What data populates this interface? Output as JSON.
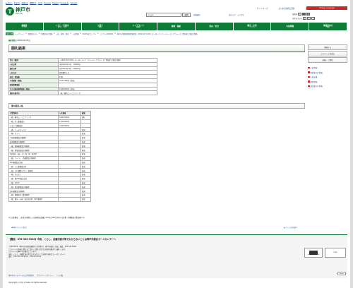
{
  "header": {
    "top_links": [
      "▶ 本文へ",
      "English",
      "简体中文",
      "繁體中文",
      "한국어",
      "Français",
      "Español",
      "Português",
      "Vietnam"
    ],
    "logo_text": "神戸市",
    "logo_sub": "Kobe City",
    "logo_mark": "T",
    "sitemap": "サイトマップ",
    "faq": "よくある質問と回答",
    "language": "Foreign Language",
    "search_placeholder": "Google",
    "search_button": "検索",
    "detail_search": "詳細検索",
    "reading": "読み上げ・ふりがな",
    "bg_label": "背景色",
    "text_size_label": "文字の大きさ",
    "bg_options": [
      "白",
      "黒",
      "青"
    ],
    "text_options": [
      "小",
      "中",
      "大"
    ]
  },
  "nav": [
    {
      "label": "事業者",
      "sub": "ポータル"
    },
    {
      "label": "くらし・手続き",
      "sub": "暮らし・生活"
    },
    {
      "label": "子育て",
      "sub": "教育"
    },
    {
      "label": "シニアライフ",
      "sub": "高齢者"
    },
    {
      "label": "健康・福祉",
      "sub": ""
    },
    {
      "label": "防災・安全",
      "sub": ""
    },
    {
      "label": "観光・文化",
      "sub": "イベント"
    },
    {
      "label": "市政情報",
      "sub": ""
    },
    {
      "label": "事業者向け",
      "sub": "情報"
    }
  ],
  "breadcrumb": {
    "label": "現在位置",
    "items": [
      "トップページ",
      "事業者の方へ",
      "事業者向け情報",
      "入札・契約・税金",
      "入札情報",
      "2020年度コンサル",
      "コンサル2020011",
      "神戸市付駅前開発事業調査（2020-0171-001）オーダーアイランドムービングウォーク上置前庭工事設計業務"
    ]
  },
  "updated": {
    "label": "最終更新日",
    "value": "2020年12月25日"
  },
  "main": {
    "title": "開札結果",
    "info_rows": [
      {
        "label": "件名（種別）",
        "value": "（2020-0171-001）オーダーアイランドムービングウォーク上置前庭工事設計業務"
      },
      {
        "label": "入札日時",
        "value": "令和2年9月11日　10時00分"
      },
      {
        "label": "開札日時",
        "value": "令和2年9月11日　10時10分"
      },
      {
        "label": "入札方式",
        "value": "指名競争入札"
      },
      {
        "label": "指名・参加数",
        "value": "23者"
      },
      {
        "label": "予定価格（税抜）",
        "value": "3,247,000円（税抜）"
      },
      {
        "label": "最低制限価格",
        "value": ""
      },
      {
        "label": "または調査基準価格（税抜）",
        "value": "2,489,600円（税抜）"
      },
      {
        "label": "契約の相手方",
        "value": "（株）横浜エンジニアリング"
      }
    ],
    "section_title": "第1回目入札",
    "bid_headers": [
      "企業団体名",
      "入札価格",
      "結果"
    ],
    "bids": [
      {
        "company": "（株）横浜エンジニアリング",
        "price": "3,000,000円",
        "result": "落札"
      },
      {
        "company": "（株）ゼン建築設計",
        "price": "3,100,000円",
        "result": ""
      },
      {
        "company": "キタムラ建築設計",
        "price": "3,200,000円",
        "result": ""
      },
      {
        "company": "（株）アーキボックス",
        "price": "",
        "result": "辞退"
      },
      {
        "company": "（株）キュー",
        "price": "",
        "result": "辞退"
      },
      {
        "company": "小田原建築設計事務所",
        "price": "",
        "result": "辞退"
      },
      {
        "company": "松本建築設計事務所",
        "price": "",
        "result": "辞退"
      },
      {
        "company": "（株）奥林建築設計事務所",
        "price": "",
        "result": "辞退"
      },
      {
        "company": "（株）地域環境設計事務所",
        "price": "",
        "result": "辞退"
      },
      {
        "company": "全和設計（株）・木・窓・秘・研究所",
        "price": "",
        "result": "辞退"
      },
      {
        "company": "（株）アーバン・西建築設計事務所",
        "price": "",
        "result": "辞退"
      },
      {
        "company": "Min建築設計企画",
        "price": "",
        "result": "辞退"
      },
      {
        "company": "（株）うぃ建築設計室",
        "price": "",
        "result": "辞退"
      },
      {
        "company": "（株）core建築デザイン事務所",
        "price": "",
        "result": "辞退"
      },
      {
        "company": "（株）かんだて",
        "price": "",
        "result": "辞退"
      },
      {
        "company": "（株）神戸KQ設計会社",
        "price": "",
        "result": "辞退"
      },
      {
        "company": "（株）Z-TOT",
        "price": "",
        "result": "辞退"
      },
      {
        "company": "（株）周辺建築設計事務所",
        "price": "",
        "result": "辞退"
      },
      {
        "company": "長村建築設計事務所",
        "price": "",
        "result": "辞退"
      },
      {
        "company": "（株）建築設計工業事務所",
        "price": "",
        "result": "辞退"
      },
      {
        "company": "（株）郡市・計画・設計研究所　神戸事務所",
        "price": "",
        "result": "辞退"
      }
    ],
    "note": "※上記金額は、入札者が見積もった契約希望金額の110分の100に相当する金額（消費税抜き税金額です）",
    "prev_link": "前のページへ戻る",
    "top_link": "ページの先頭へ"
  },
  "sidebar": {
    "buttons": [
      "印刷する",
      "このページを送る",
      "評価・ご意見"
    ],
    "links": [
      "入札情報",
      "事業者向け情報",
      "入札結果",
      "契約情報",
      "事業者向け情報"
    ]
  },
  "footer": {
    "call_line": "【電話：078-333-3330】市政、くらし、各種手続き等でわからないことは神戸市総合コールセンターへ",
    "address_lines": [
      "〒650-8570　神戸市中央区加納町6丁目5番1号　神戸市役所（代表）電話：078-331-8181",
      "このページの内容に関するご意見・お問い合わせは各担当課までお願いします。",
      "このページは神戸市が運営しています。",
      "市政、くらし、各種手続き等でわからないことは神戸市総合コールセンターへ",
      "電話：078-333-3330 Fax：078-333-3314"
    ],
    "unesco_text": "Creative City DESIGN",
    "creative_text": "KOBE",
    "share_label": "Share",
    "links": [
      "神戸市ホームページのご利用案内",
      "プライバシーポリシー",
      "リンク集"
    ],
    "copyright": "Copyright (c) City of Kobe. All rights reserved."
  }
}
